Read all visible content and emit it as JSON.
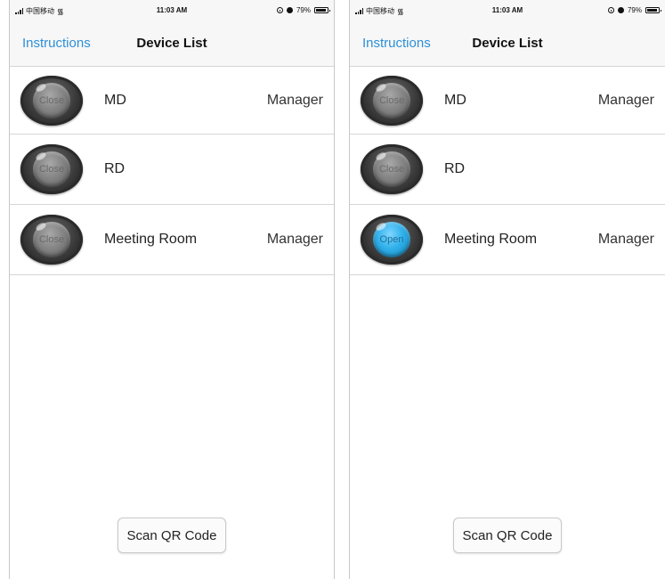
{
  "screens": [
    {
      "status_bar": {
        "carrier": "中国移动",
        "time": "11:03 AM",
        "battery": "79%"
      },
      "nav": {
        "back_label": "Instructions",
        "title": "Device List"
      },
      "devices": [
        {
          "name": "MD",
          "state_label": "Close",
          "state": "closed",
          "role": "Manager"
        },
        {
          "name": "RD",
          "state_label": "Close",
          "state": "closed",
          "role": ""
        },
        {
          "name": "Meeting Room",
          "state_label": "Close",
          "state": "closed",
          "role": "Manager"
        }
      ],
      "scan_button": "Scan QR Code"
    },
    {
      "status_bar": {
        "carrier": "中国移动",
        "time": "11:03 AM",
        "battery": "79%"
      },
      "nav": {
        "back_label": "Instructions",
        "title": "Device List"
      },
      "devices": [
        {
          "name": "MD",
          "state_label": "Close",
          "state": "closed",
          "role": "Manager"
        },
        {
          "name": "RD",
          "state_label": "Close",
          "state": "closed",
          "role": ""
        },
        {
          "name": "Meeting Room",
          "state_label": "Open",
          "state": "open",
          "role": "Manager"
        }
      ],
      "scan_button": "Scan QR Code"
    }
  ],
  "colors": {
    "accent": "#2d8fd6",
    "open_lamp": "#2fb0ea",
    "closed_lamp": "#3a3a3a"
  },
  "icons": [
    "signal-icon",
    "wifi-icon",
    "location-icon",
    "alarm-icon",
    "battery-icon"
  ]
}
